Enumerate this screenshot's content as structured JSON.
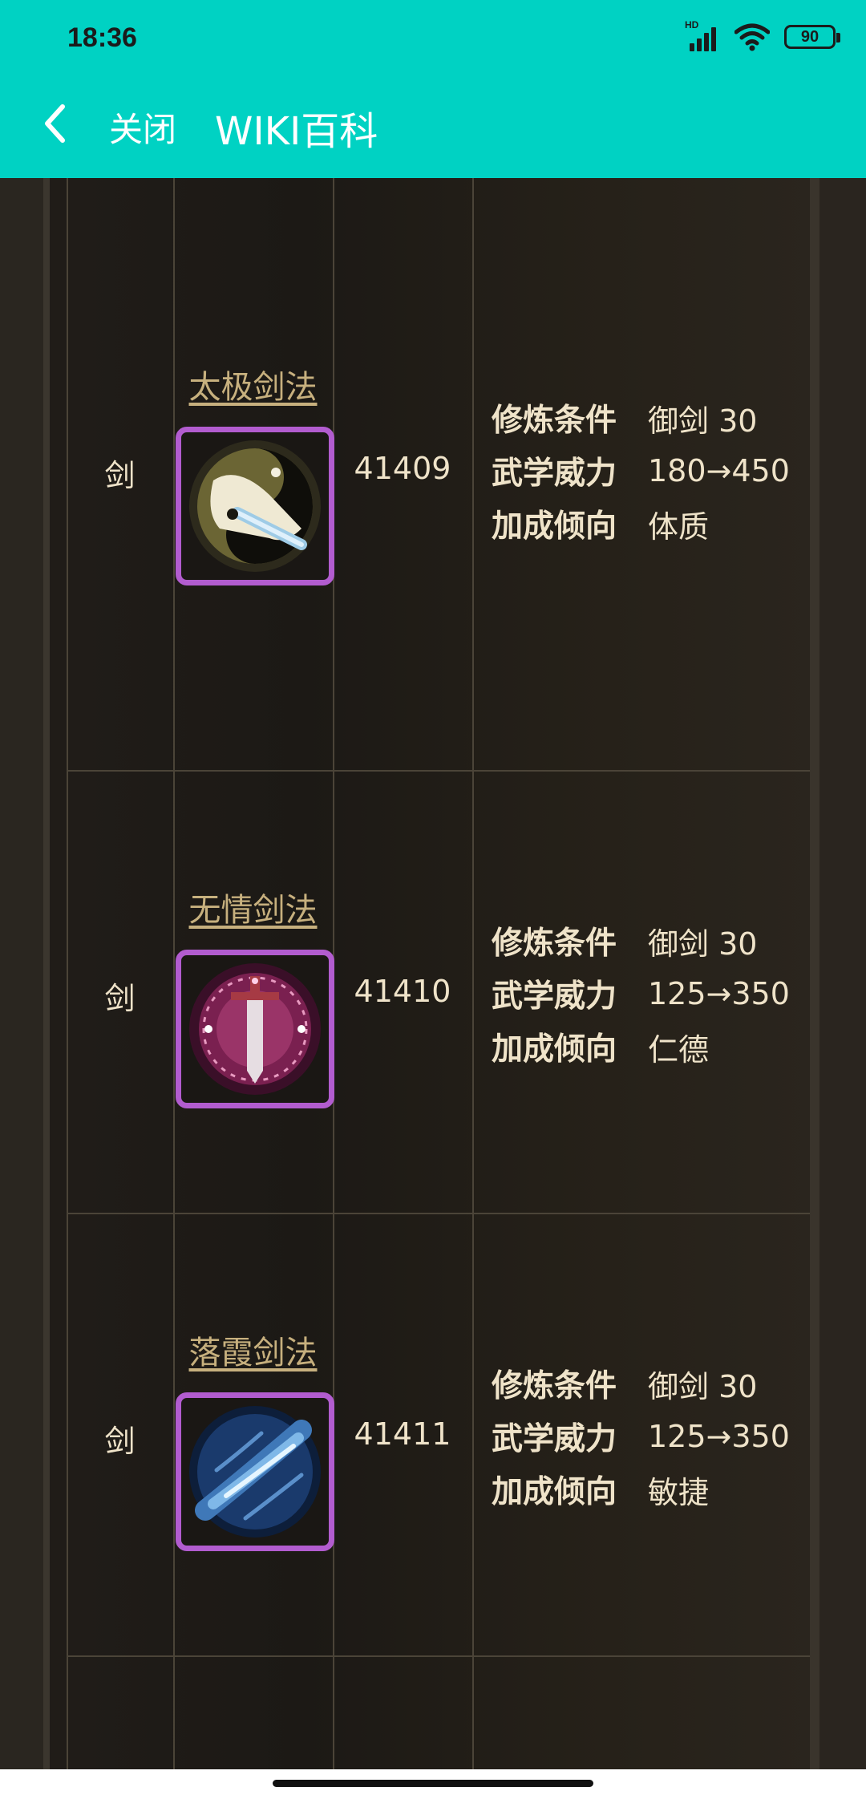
{
  "status_bar": {
    "time": "18:36",
    "network_label": "HD",
    "battery": "90"
  },
  "header": {
    "back_icon": "chevron-left-icon",
    "close_label": "关闭",
    "title": "WIKI百科"
  },
  "skills": [
    {
      "type": "剑",
      "name": "太极剑法",
      "icon": "taiji-sword-icon",
      "id": "41409",
      "attributes": [
        {
          "label": "修炼条件",
          "value": "御剑 30"
        },
        {
          "label": "武学威力",
          "value": "180→450"
        },
        {
          "label": "加成倾向",
          "value": "体质"
        }
      ]
    },
    {
      "type": "剑",
      "name": "无情剑法",
      "icon": "ruthless-sword-icon",
      "id": "41410",
      "attributes": [
        {
          "label": "修炼条件",
          "value": "御剑 30"
        },
        {
          "label": "武学威力",
          "value": "125→350"
        },
        {
          "label": "加成倾向",
          "value": "仁德"
        }
      ]
    },
    {
      "type": "剑",
      "name": "落霞剑法",
      "icon": "sunset-sword-icon",
      "id": "41411",
      "attributes": [
        {
          "label": "修炼条件",
          "value": "御剑 30"
        },
        {
          "label": "武学威力",
          "value": "125→350"
        },
        {
          "label": "加成倾向",
          "value": "敏捷"
        }
      ]
    }
  ],
  "colors": {
    "header_bg": "#00d2c3",
    "icon_border": "#b25ccf",
    "link_text": "#c7b07e",
    "body_text": "#efe3c9"
  }
}
